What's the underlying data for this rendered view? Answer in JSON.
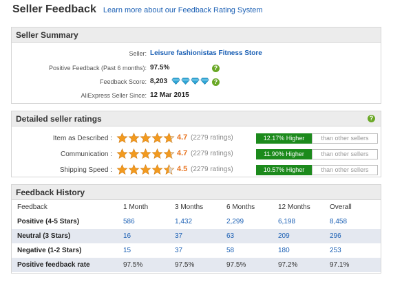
{
  "header": {
    "title": "Seller Feedback",
    "link": "Learn more about our Feedback Rating System"
  },
  "summary": {
    "title": "Seller Summary",
    "seller_label": "Seller:",
    "seller_name": "Leisure fashionistas Fitness Store",
    "positive_label": "Positive Feedback (Past 6 months):",
    "positive_value": "97.5%",
    "score_label": "Feedback Score:",
    "score_value": "8,203",
    "score_diamonds": 4,
    "since_label": "AliExpress Seller Since:",
    "since_value": "12 Mar 2015"
  },
  "ratings": {
    "title": "Detailed seller ratings",
    "rows": [
      {
        "label": "Item as Described :",
        "score": "4.7",
        "stars": 4.7,
        "count": "(2279 ratings)",
        "higher": "12.17% Higher",
        "other": "than other sellers"
      },
      {
        "label": "Communication :",
        "score": "4.7",
        "stars": 4.7,
        "count": "(2279 ratings)",
        "higher": "11.90% Higher",
        "other": "than other sellers"
      },
      {
        "label": "Shipping Speed :",
        "score": "4.5",
        "stars": 4.5,
        "count": "(2279 ratings)",
        "higher": "10.57% Higher",
        "other": "than other sellers"
      }
    ]
  },
  "history": {
    "title": "Feedback History",
    "columns": [
      "Feedback",
      "1 Month",
      "3 Months",
      "6 Months",
      "12 Months",
      "Overall"
    ],
    "rows": [
      {
        "label": "Positive (4-5 Stars)",
        "values": [
          "586",
          "1,432",
          "2,299",
          "6,198",
          "8,458"
        ]
      },
      {
        "label": "Neutral (3 Stars)",
        "values": [
          "16",
          "37",
          "63",
          "209",
          "296"
        ]
      },
      {
        "label": "Negative (1-2 Stars)",
        "values": [
          "15",
          "37",
          "58",
          "180",
          "253"
        ]
      },
      {
        "label": "Positive feedback rate",
        "values": [
          "97.5%",
          "97.5%",
          "97.5%",
          "97.2%",
          "97.1%"
        ]
      }
    ]
  },
  "colors": {
    "star": "#f29a1f",
    "star_empty": "#d9d9d9",
    "diamond": "#2fa8d8",
    "higher_bg": "#1c8a1c",
    "link": "#1a5fb4"
  },
  "icons": {
    "help": "?"
  }
}
